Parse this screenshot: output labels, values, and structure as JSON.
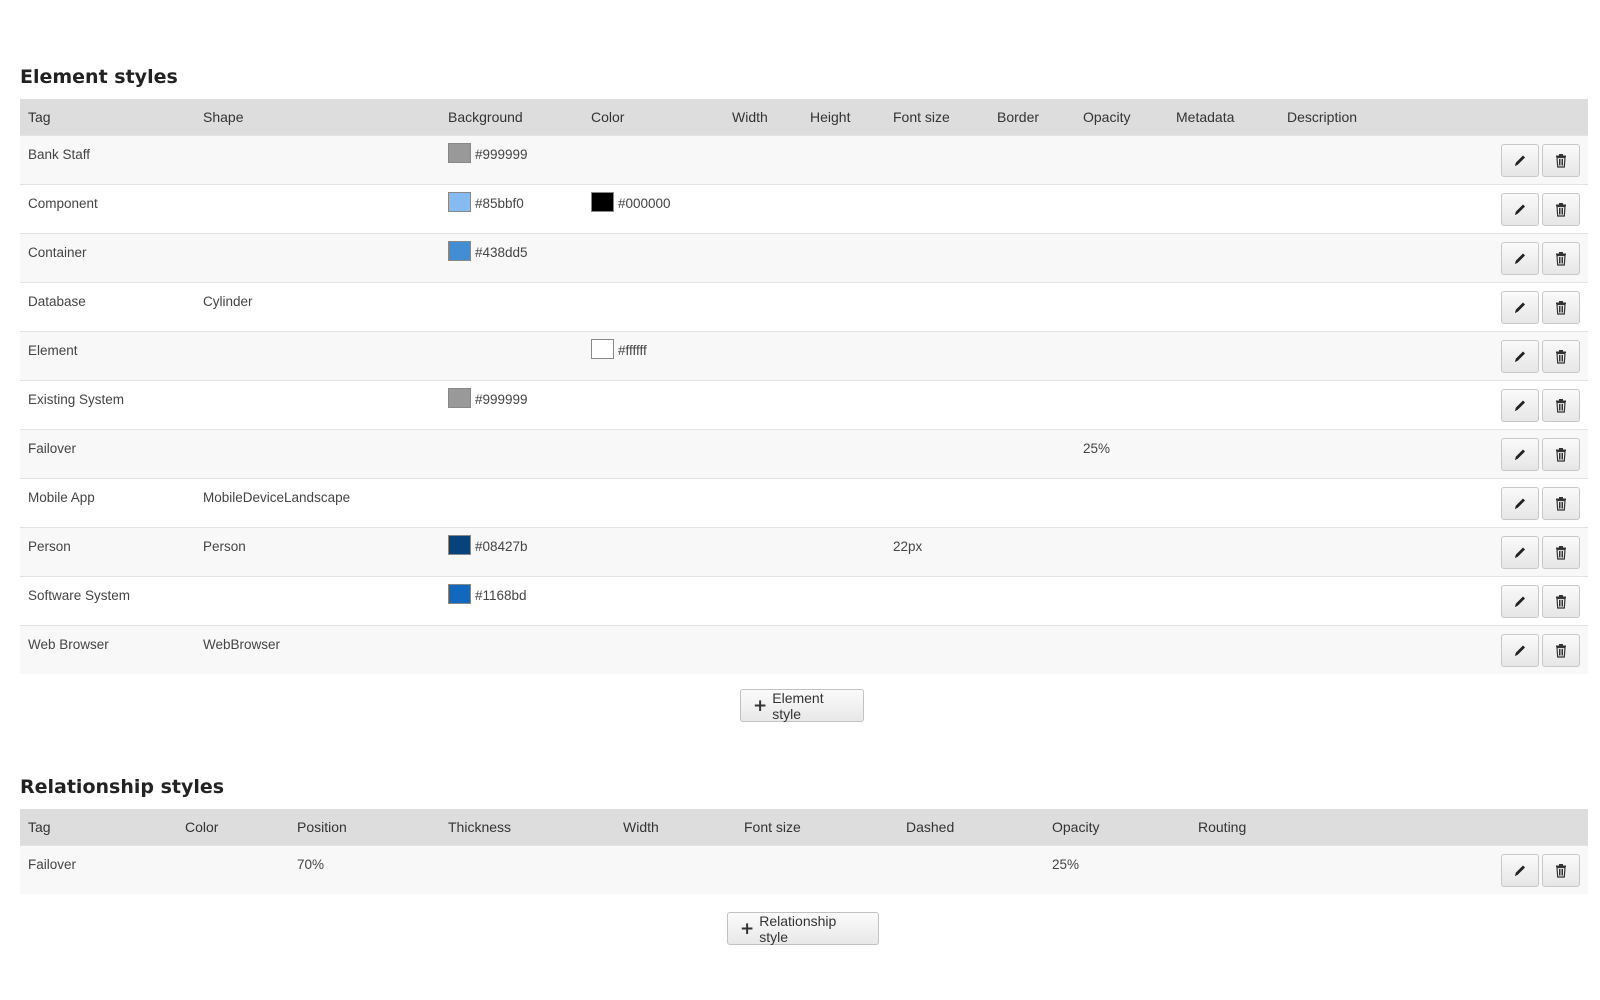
{
  "element_styles": {
    "title": "Element styles",
    "columns": [
      "Tag",
      "Shape",
      "Background",
      "Color",
      "Width",
      "Height",
      "Font size",
      "Border",
      "Opacity",
      "Metadata",
      "Description"
    ],
    "rows": [
      {
        "tag": "Bank Staff",
        "shape": "",
        "background": "#999999",
        "color": "",
        "width": "",
        "height": "",
        "font_size": "",
        "border": "",
        "opacity": "",
        "metadata": "",
        "description": ""
      },
      {
        "tag": "Component",
        "shape": "",
        "background": "#85bbf0",
        "color": "#000000",
        "width": "",
        "height": "",
        "font_size": "",
        "border": "",
        "opacity": "",
        "metadata": "",
        "description": ""
      },
      {
        "tag": "Container",
        "shape": "",
        "background": "#438dd5",
        "color": "",
        "width": "",
        "height": "",
        "font_size": "",
        "border": "",
        "opacity": "",
        "metadata": "",
        "description": ""
      },
      {
        "tag": "Database",
        "shape": "Cylinder",
        "background": "",
        "color": "",
        "width": "",
        "height": "",
        "font_size": "",
        "border": "",
        "opacity": "",
        "metadata": "",
        "description": ""
      },
      {
        "tag": "Element",
        "shape": "",
        "background": "",
        "color": "#ffffff",
        "width": "",
        "height": "",
        "font_size": "",
        "border": "",
        "opacity": "",
        "metadata": "",
        "description": ""
      },
      {
        "tag": "Existing System",
        "shape": "",
        "background": "#999999",
        "color": "",
        "width": "",
        "height": "",
        "font_size": "",
        "border": "",
        "opacity": "",
        "metadata": "",
        "description": ""
      },
      {
        "tag": "Failover",
        "shape": "",
        "background": "",
        "color": "",
        "width": "",
        "height": "",
        "font_size": "",
        "border": "",
        "opacity": "25%",
        "metadata": "",
        "description": ""
      },
      {
        "tag": "Mobile App",
        "shape": "MobileDeviceLandscape",
        "background": "",
        "color": "",
        "width": "",
        "height": "",
        "font_size": "",
        "border": "",
        "opacity": "",
        "metadata": "",
        "description": ""
      },
      {
        "tag": "Person",
        "shape": "Person",
        "background": "#08427b",
        "color": "",
        "width": "",
        "height": "",
        "font_size": "22px",
        "border": "",
        "opacity": "",
        "metadata": "",
        "description": ""
      },
      {
        "tag": "Software System",
        "shape": "",
        "background": "#1168bd",
        "color": "",
        "width": "",
        "height": "",
        "font_size": "",
        "border": "",
        "opacity": "",
        "metadata": "",
        "description": ""
      },
      {
        "tag": "Web Browser",
        "shape": "WebBrowser",
        "background": "",
        "color": "",
        "width": "",
        "height": "",
        "font_size": "",
        "border": "",
        "opacity": "",
        "metadata": "",
        "description": ""
      }
    ],
    "add_button_label": "Element style"
  },
  "relationship_styles": {
    "title": "Relationship styles",
    "columns": [
      "Tag",
      "Color",
      "Position",
      "Thickness",
      "Width",
      "Font size",
      "Dashed",
      "Opacity",
      "Routing"
    ],
    "rows": [
      {
        "tag": "Failover",
        "color": "",
        "position": "70%",
        "thickness": "",
        "width": "",
        "font_size": "",
        "dashed": "",
        "opacity": "25%",
        "routing": ""
      }
    ],
    "add_button_label": "Relationship style"
  },
  "icons": {
    "edit": "pencil-icon",
    "delete": "trash-icon",
    "add": "plus-icon"
  }
}
